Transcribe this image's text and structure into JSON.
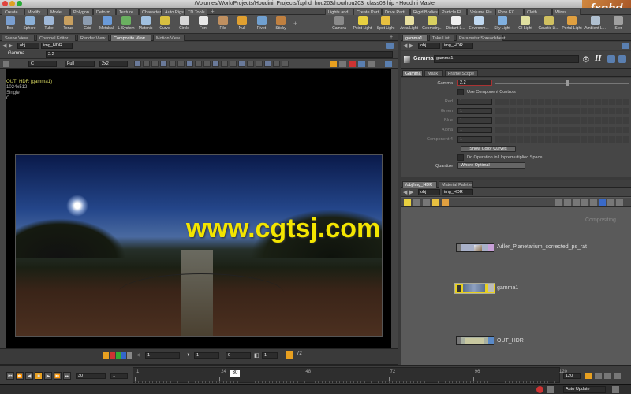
{
  "window": {
    "title": "/Volumes/Work/Projects/Houdini_Projects/fxphd_hou203/hou/hou203_class08.hip - Houdini Master"
  },
  "watermark": {
    "logo": "fxphd",
    "site": "www.cgtsj.com"
  },
  "shelf": {
    "left_tabs": [
      "Create",
      "Modify",
      "Model",
      "Polygon",
      "Deform",
      "Texture",
      "Character",
      "Auto Rigs",
      "TD Tools"
    ],
    "right_tabs": [
      "Lights and...",
      "Create Part...",
      "Drive Parti...",
      "Rigid Bodies",
      "Particle Fl...",
      "Volume Flu...",
      "Pyro FX",
      "Cloth",
      "Wires"
    ],
    "left_tools": [
      "Box",
      "Sphere",
      "Tube",
      "Torus",
      "Grid",
      "Metaball",
      "L-System",
      "Platonic",
      "Curve",
      "Circle",
      "Font",
      "File",
      "Null",
      "Rivet",
      "Sticky"
    ],
    "right_tools": [
      "Camera",
      "Point Light",
      "Spot Light",
      "Area Light",
      "Geometry...",
      "Distant L...",
      "Environm...",
      "Sky Light",
      "GI Light",
      "Caustic Li...",
      "Portal Light",
      "Ambient L...",
      "Ster"
    ]
  },
  "viewer": {
    "tabs": [
      "Scene View",
      "Channel Editor",
      "Render View",
      "Composite View",
      "Motion View"
    ],
    "active_tab": "Composite View",
    "path": [
      "obj",
      "img_HDR"
    ],
    "param_label": "Gamma",
    "param_value": "2.2",
    "plane": "C",
    "quality": "Full",
    "zoom": "2x2",
    "info": [
      "OUT_HDR (gamma1)",
      "1024x512",
      "Single",
      "C"
    ],
    "bottom_fields": [
      "1",
      "1",
      "0",
      "1"
    ],
    "bottom_num": "72"
  },
  "params": {
    "tabs": [
      "gamma1",
      "Take List",
      "Parameter Spreadsheet"
    ],
    "path": [
      "obj",
      "img_HDR"
    ],
    "node_type": "Gamma",
    "node_name": "gamma1",
    "subtabs": [
      "Gamma",
      "Mask",
      "Frame Scope"
    ],
    "gamma_label": "Gamma",
    "gamma_value": "2.2",
    "use_component_label": "Use Component Controls",
    "components": [
      {
        "label": "Red",
        "value": "1"
      },
      {
        "label": "Green",
        "value": "1"
      },
      {
        "label": "Blue",
        "value": "1"
      },
      {
        "label": "Alpha",
        "value": "1"
      },
      {
        "label": "Component 4",
        "value": "1"
      }
    ],
    "show_curves": "Show Color Curves",
    "unpremult_label": "Do Operation in Unpremultiplied Space",
    "quantize_label": "Quantize",
    "quantize_value": "Where Optimal"
  },
  "network": {
    "tabs": [
      "/obj/img_HDR",
      "Material Palette"
    ],
    "path": [
      "obj",
      "img_HDR"
    ],
    "context_label": "Compositing",
    "nodes": [
      {
        "name": "Adler_Planetarium_corrected_ps_rat"
      },
      {
        "name": "gamma1"
      },
      {
        "name": "OUT_HDR"
      }
    ]
  },
  "timeline": {
    "start": "1",
    "frame": "30",
    "step": "1",
    "ticks": [
      "1",
      "24",
      "48",
      "72",
      "96",
      "120"
    ],
    "current": "30",
    "end": "120",
    "auto_update": "Auto Update"
  },
  "colors": {
    "accent_orange": "#e8a020",
    "selected_yellow": "#e8d020",
    "network_bg": "#5a5a5a"
  }
}
